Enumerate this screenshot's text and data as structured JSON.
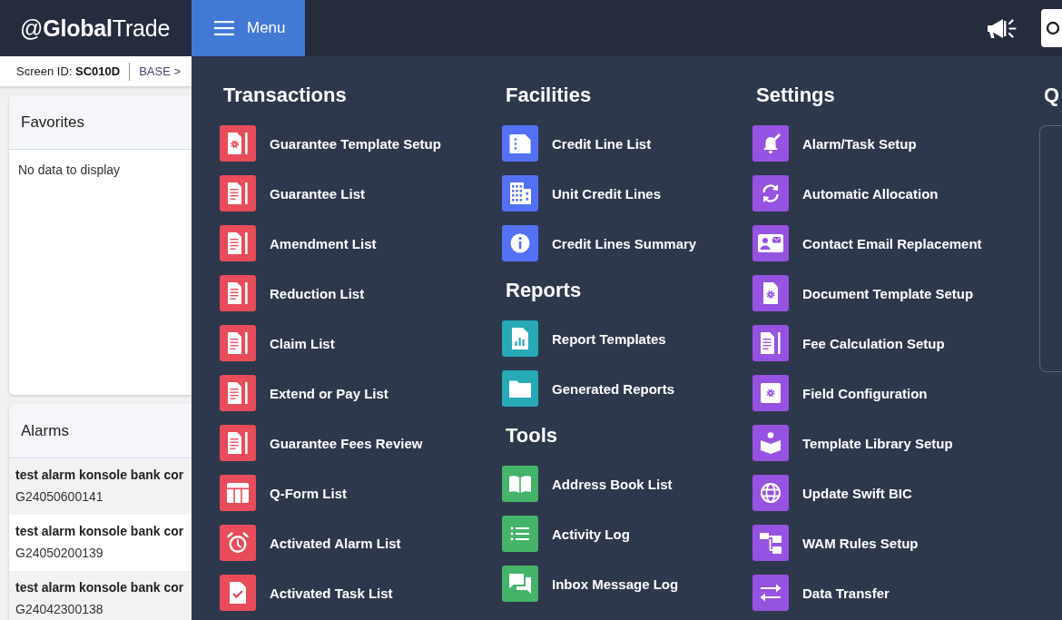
{
  "header": {
    "logo": "@**Global**Trade",
    "menu_button": {
      "label": "Menu",
      "expanded": true
    }
  },
  "breadcrumb": {
    "screen_id": "Screen ID: **SC010D**",
    "path": "BASE >"
  },
  "favorites": {
    "title": "Favorites",
    "empty_text": "No data to display"
  },
  "alarms": {
    "title": "Alarms",
    "rows": [
      {
        "title": "test alarm konsole bank cor",
        "reference": "G24050600141"
      },
      {
        "title": "test alarm konsole bank cor",
        "reference": "G24050200139"
      },
      {
        "title": "test alarm konsole bank cor",
        "reference": "G24042300138"
      }
    ]
  },
  "menu": {
    "columns": [
      {
        "sections": [
          {
            "title": "Transactions",
            "color": "#e84c5a",
            "items": [
              {
                "label": "Guarantee Template Setup",
                "kind": "template"
              },
              {
                "label": "Guarantee List",
                "kind": "document"
              },
              {
                "label": "Amendment List",
                "kind": "document"
              },
              {
                "label": "Reduction List",
                "kind": "document"
              },
              {
                "label": "Claim List",
                "kind": "document"
              },
              {
                "label": "Extend or Pay List",
                "kind": "document"
              },
              {
                "label": "Guarantee Fees Review",
                "kind": "document"
              },
              {
                "label": "Q-Form List",
                "kind": "table"
              },
              {
                "label": "Activated Alarm List",
                "kind": "alarm"
              },
              {
                "label": "Activated Task List",
                "kind": "task"
              }
            ]
          }
        ]
      },
      {
        "sections": [
          {
            "title": "Facilities",
            "color": "#5470f5",
            "items": [
              {
                "label": "Credit Line List",
                "kind": "ledger"
              },
              {
                "label": "Unit Credit Lines",
                "kind": "building"
              },
              {
                "label": "Credit Lines Summary",
                "kind": "info"
              }
            ]
          },
          {
            "title": "Reports",
            "color": "#27a9b6",
            "items": [
              {
                "label": "Report Templates",
                "kind": "report"
              },
              {
                "label": "Generated Reports",
                "kind": "folder"
              }
            ]
          },
          {
            "title": "Tools",
            "color": "#45b46a",
            "items": [
              {
                "label": "Address Book List",
                "kind": "book"
              },
              {
                "label": "Activity Log",
                "kind": "list"
              },
              {
                "label": "Inbox Message Log",
                "kind": "chat"
              }
            ]
          }
        ]
      },
      {
        "sections": [
          {
            "title": "Settings",
            "color": "#9652e0",
            "items": [
              {
                "label": "Alarm/Task Setup",
                "kind": "bell"
              },
              {
                "label": "Automatic Allocation",
                "kind": "refresh"
              },
              {
                "label": "Contact Email Replacement",
                "kind": "contact"
              },
              {
                "label": "Document Template Setup",
                "kind": "gearpage"
              },
              {
                "label": "Fee Calculation Setup",
                "kind": "document"
              },
              {
                "label": "Field Configuration",
                "kind": "config"
              },
              {
                "label": "Template Library Setup",
                "kind": "library"
              },
              {
                "label": "Update Swift BIC",
                "kind": "globe"
              },
              {
                "label": "WAM Rules Setup",
                "kind": "hierarchy"
              },
              {
                "label": "Data Transfer",
                "kind": "transfer"
              }
            ]
          }
        ]
      }
    ],
    "column_4": {
      "heading": "Q"
    }
  }
}
